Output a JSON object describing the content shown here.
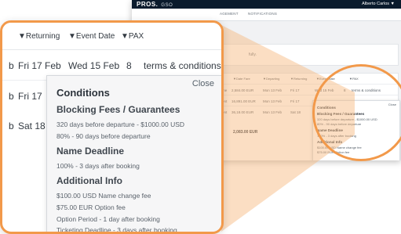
{
  "background_app": {
    "logo": "PROS.",
    "product": "GSO",
    "user": "Alberto Carlos ▼",
    "nav": [
      "AGEMENT",
      "NOTIFICATIONS"
    ],
    "message": "fully.",
    "headers": [
      "▼Date Fare",
      "▼Departing",
      "▼Returning",
      "▼Event Date",
      "▼PAX"
    ],
    "rows": [
      [
        "me",
        "2,584.00 EUR",
        "Mon 13 Feb",
        "Fri 17",
        "Wed 15 Feb",
        "8",
        "terms & conditions"
      ],
      [
        "ent",
        "16,891.00 EUR",
        "Mon 13 Feb",
        "Fri 17"
      ],
      [
        "ent",
        "36,18.00 EUR",
        "Mon 13 Feb",
        "Sat 18"
      ]
    ],
    "total": "2,083.00 EUR",
    "popup": {
      "close": "Close",
      "title": "Conditions",
      "lines": [
        "Blocking Fees / Guarantees",
        "320 days before departure - $1000.00 USD",
        "80% - 90 days before departure",
        "Name Deadline",
        "100% - 3 days after booking",
        "Additional Info",
        "$100.00 USD Name change fee",
        "$75.00 EUR Option fee"
      ]
    }
  },
  "zoom": {
    "columns": [
      "▼Returning",
      "▼Event Date",
      "▼PAX"
    ],
    "rows": [
      {
        "lead": "b",
        "returning": "Fri 17 Feb",
        "event_date": "Wed 15 Feb",
        "pax": "8",
        "link": "terms & conditions"
      },
      {
        "lead": "b",
        "returning": "Fri 17",
        "event_date": "",
        "pax": "",
        "link": ""
      },
      {
        "lead": "b",
        "returning": "Sat 18",
        "event_date": "",
        "pax": "",
        "link": ""
      }
    ],
    "popover": {
      "close": "Close",
      "title": "Conditions",
      "section1_title": "Blocking Fees / Guarantees",
      "section1_lines": [
        "320 days before departure - $1000.00 USD",
        "80% - 90 days before departure"
      ],
      "section2_title": "Name Deadline",
      "section2_lines": [
        "100% - 3 days after booking"
      ],
      "section3_title": "Additional Info",
      "section3_lines": [
        "$100.00 USD Name change fee",
        "$75.00 EUR Option fee",
        "Option Period - 1 day after booking",
        "Ticketing Deadline - 3 days after booking"
      ]
    }
  },
  "colors": {
    "accent": "#f2994a",
    "topbar": "#0a1b2d"
  }
}
